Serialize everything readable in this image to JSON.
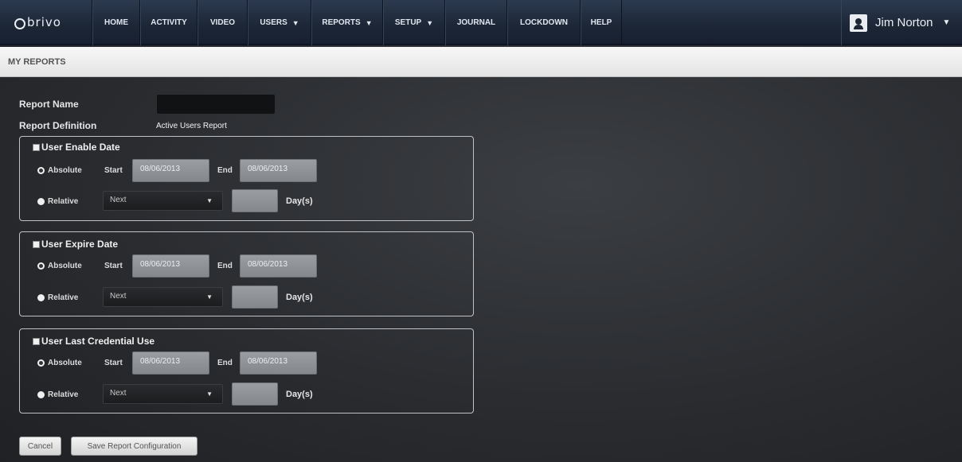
{
  "nav": {
    "logo": "brivo",
    "items": [
      {
        "label": "HOME",
        "caret": false
      },
      {
        "label": "ACTIVITY",
        "caret": false
      },
      {
        "label": "VIDEO",
        "caret": false
      },
      {
        "label": "USERS",
        "caret": true
      },
      {
        "label": "REPORTS",
        "caret": true
      },
      {
        "label": "SETUP",
        "caret": true
      },
      {
        "label": "JOURNAL",
        "caret": false
      },
      {
        "label": "LOCKDOWN",
        "caret": false
      },
      {
        "label": "HELP",
        "caret": false
      }
    ],
    "user_name": "Jim Norton"
  },
  "page_title": "MY REPORTS",
  "form": {
    "report_name_label": "Report Name",
    "report_name_value": "",
    "report_definition_label": "Report Definition",
    "report_definition_value": "Active Users Report",
    "groups": [
      {
        "title": "User Enable Date",
        "checked": false,
        "absolute_label": "Absolute",
        "absolute_selected": true,
        "start_label": "Start",
        "start_value": "08/06/2013",
        "end_label": "End",
        "end_value": "08/06/2013",
        "relative_label": "Relative",
        "relative_select": "Next",
        "days_value": "",
        "days_label": "Day(s)"
      },
      {
        "title": "User Expire Date",
        "checked": false,
        "absolute_label": "Absolute",
        "absolute_selected": true,
        "start_label": "Start",
        "start_value": "08/06/2013",
        "end_label": "End",
        "end_value": "08/06/2013",
        "relative_label": "Relative",
        "relative_select": "Next",
        "days_value": "",
        "days_label": "Day(s)"
      },
      {
        "title": "User Last Credential Use",
        "checked": false,
        "absolute_label": "Absolute",
        "absolute_selected": true,
        "start_label": "Start",
        "start_value": "08/06/2013",
        "end_label": "End",
        "end_value": "08/06/2013",
        "relative_label": "Relative",
        "relative_select": "Next",
        "days_value": "",
        "days_label": "Day(s)"
      }
    ]
  },
  "buttons": {
    "cancel": "Cancel",
    "save": "Save Report Configuration"
  }
}
